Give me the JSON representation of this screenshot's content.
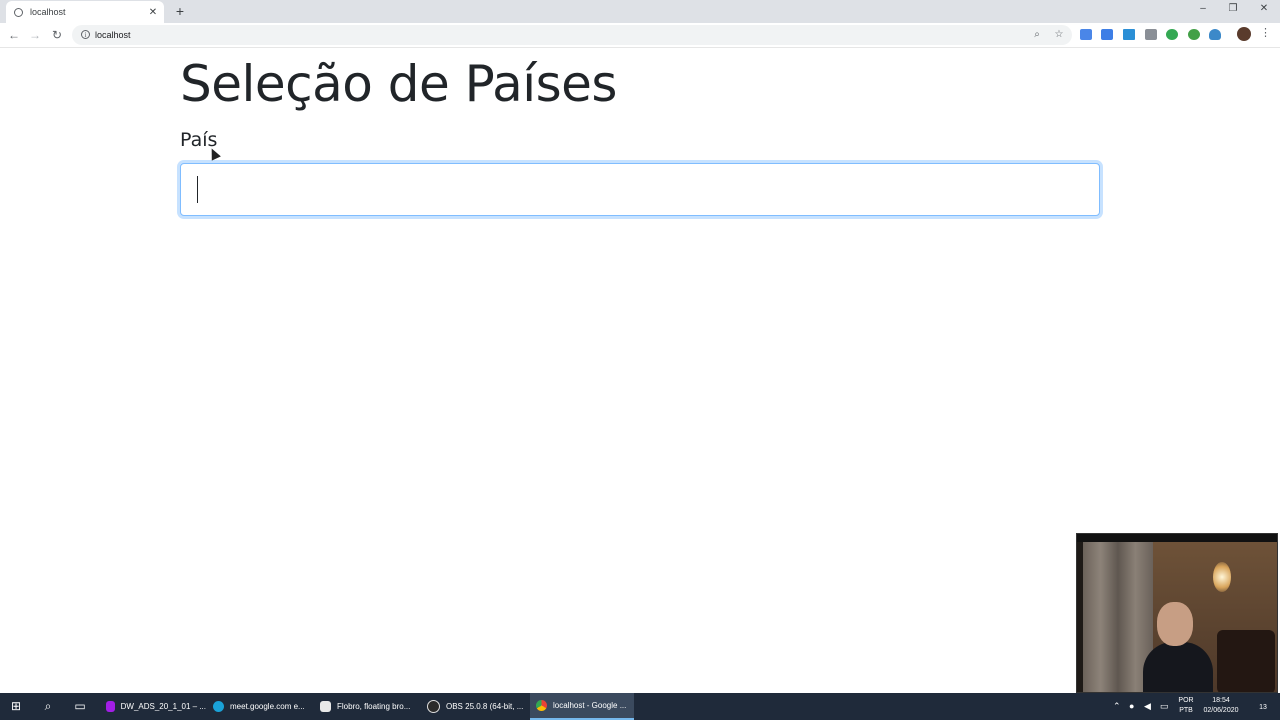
{
  "browser": {
    "tab_title": "localhost",
    "url": "localhost",
    "new_tab_symbol": "+",
    "close_symbol": "✕"
  },
  "page": {
    "title": "Seleção de Países",
    "field_label": "País",
    "input_value": "",
    "input_state": "focused"
  },
  "taskbar": {
    "apps": [
      {
        "label": "DW_ADS_20_1_01 – ...",
        "icon": "phpstorm-icon",
        "color": "#a21ee6"
      },
      {
        "label": "meet.google.com e...",
        "icon": "edge-icon",
        "color": "#1aa2d8"
      },
      {
        "label": "Flobro, floating bro...",
        "icon": "flobro-icon",
        "color": "#e8e8e8"
      },
      {
        "label": "OBS 25.0.8 (64-bit, ...",
        "icon": "obs-icon",
        "color": "#2b2b2b"
      },
      {
        "label": "localhost - Google ...",
        "icon": "chrome-icon",
        "color": "#f2b01e"
      }
    ],
    "active_app_index": 4,
    "language": "POR",
    "keyboard": "PTB",
    "time": "18:54",
    "date": "02/06/2020",
    "notifications_count": "13"
  },
  "colors": {
    "focus_border": "#80bdff",
    "text": "#212529",
    "taskbar": "#1f2a3a"
  }
}
